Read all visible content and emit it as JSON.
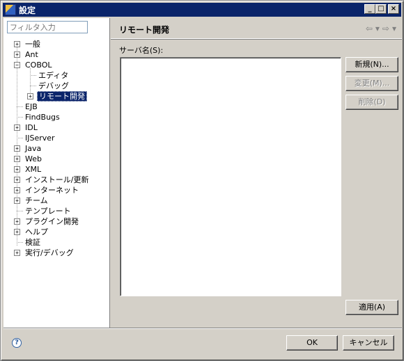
{
  "window": {
    "title": "設定",
    "min": "_",
    "max": "□",
    "close": "×"
  },
  "filter": {
    "placeholder": "フィルタ入力"
  },
  "tree": [
    {
      "label": "一般",
      "expander": "+"
    },
    {
      "label": "Ant",
      "expander": "+"
    },
    {
      "label": "COBOL",
      "expander": "−"
    },
    {
      "label": "エディタ",
      "expander": ""
    },
    {
      "label": "デバッグ",
      "expander": ""
    },
    {
      "label": "リモート開発",
      "expander": "+",
      "selected": true
    },
    {
      "label": "EJB",
      "expander": ""
    },
    {
      "label": "FindBugs",
      "expander": ""
    },
    {
      "label": "IDL",
      "expander": "+"
    },
    {
      "label": "IJServer",
      "expander": ""
    },
    {
      "label": "Java",
      "expander": "+"
    },
    {
      "label": "Web",
      "expander": "+"
    },
    {
      "label": "XML",
      "expander": "+"
    },
    {
      "label": "インストール/更新",
      "expander": "+"
    },
    {
      "label": "インターネット",
      "expander": "+"
    },
    {
      "label": "チーム",
      "expander": "+"
    },
    {
      "label": "テンプレート",
      "expander": ""
    },
    {
      "label": "プラグイン開発",
      "expander": "+"
    },
    {
      "label": "ヘルプ",
      "expander": "+"
    },
    {
      "label": "検証",
      "expander": ""
    },
    {
      "label": "実行/デバッグ",
      "expander": "+"
    }
  ],
  "page": {
    "title": "リモート開発",
    "back_arrow": "⇦",
    "forward_arrow": "⇨",
    "dropdown_arrow": "▾",
    "server_label": "サーバ名(S):",
    "buttons": {
      "new": "新規(N)...",
      "edit": "変更(M)...",
      "delete": "削除(D)",
      "apply": "適用(A)"
    }
  },
  "footer": {
    "help": "?",
    "ok": "OK",
    "cancel": "キャンセル"
  },
  "colors": {
    "title_bar": "#0a246a",
    "face": "#d4d0c8",
    "selection": "#0a246a"
  }
}
